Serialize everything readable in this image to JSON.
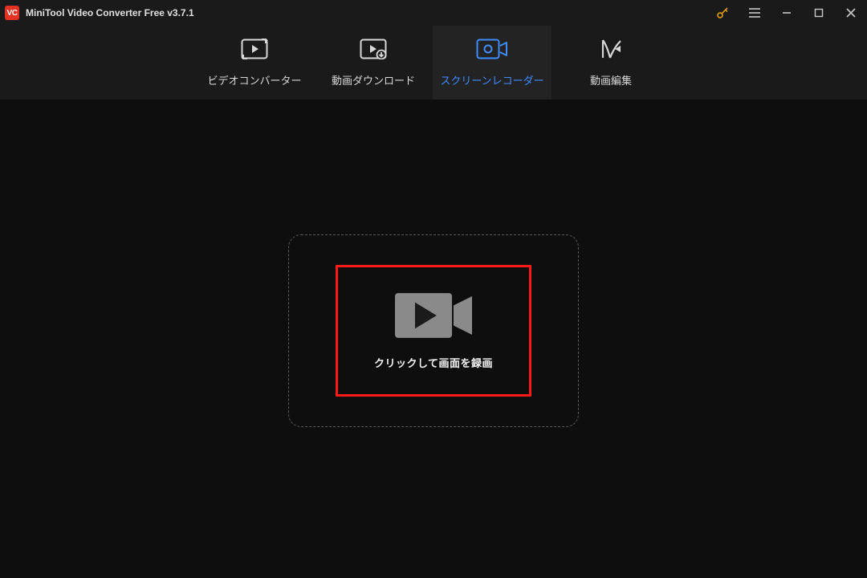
{
  "titlebar": {
    "appTitle": "MiniTool Video Converter Free v3.7.1"
  },
  "tabs": {
    "videoConverter": {
      "label": "ビデオコンバーター"
    },
    "downloader": {
      "label": "動画ダウンロード"
    },
    "recorder": {
      "label": "スクリーンレコーダー",
      "active": true
    },
    "editor": {
      "label": "動画編集"
    }
  },
  "recorder": {
    "ctaLabel": "クリックして画面を録画"
  },
  "colors": {
    "accent": "#3f8cff",
    "highlightBorder": "#ff1a1a",
    "logoBg": "#e33124"
  }
}
